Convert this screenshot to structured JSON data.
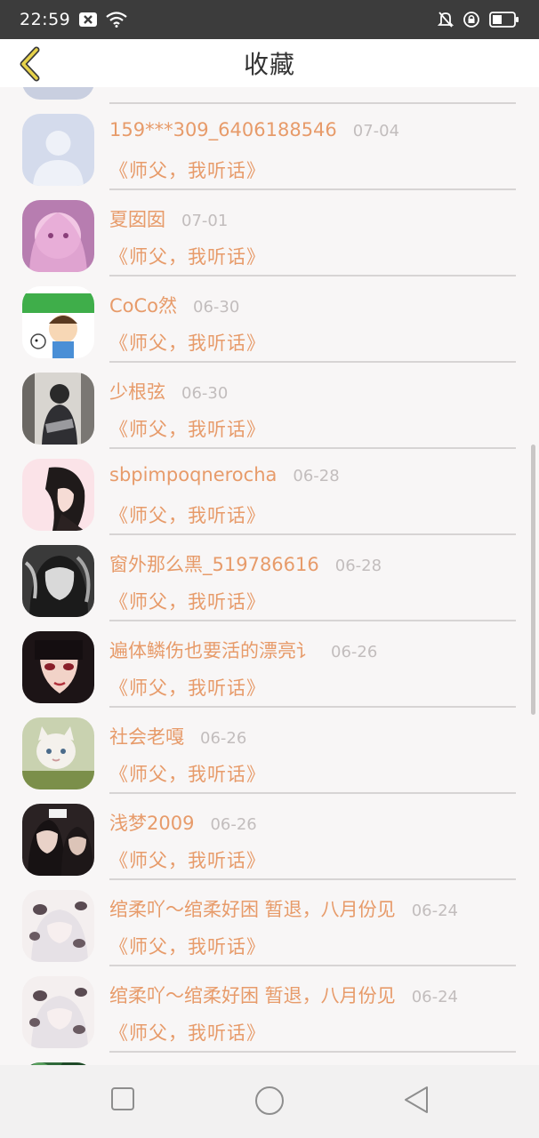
{
  "status_bar": {
    "time": "22:59",
    "left_icons": [
      "close-box-icon",
      "wifi-icon"
    ],
    "right_icons": [
      "bell-muted-icon",
      "lock-rotate-icon",
      "battery-icon"
    ]
  },
  "header": {
    "title": "收藏",
    "back_icon": "chevron-left-icon",
    "accent_color": "#e7d24a"
  },
  "colors": {
    "name_text": "#e79b6a",
    "date_text": "#c2bdbd",
    "divider": "#d7d4d4",
    "background": "#f8f6f6"
  },
  "favorites": [
    {
      "name": "",
      "date": "",
      "subtitle": "",
      "avatar": "avatar-partial"
    },
    {
      "name": "159***309_6406188546",
      "date": "07-04",
      "subtitle": "《师父，我听话》",
      "avatar": "default-avatar"
    },
    {
      "name": "夏囡囡",
      "date": "07-01",
      "subtitle": "《师父，我听话》",
      "avatar": "anime-girl-pink"
    },
    {
      "name": "CoCo然",
      "date": "06-30",
      "subtitle": "《师父，我听话》",
      "avatar": "cartoon-boy-green"
    },
    {
      "name": "少根弦",
      "date": "06-30",
      "subtitle": "《师父，我听话》",
      "avatar": "photo-person-dark"
    },
    {
      "name": "sbpimpoqnerocha",
      "date": "06-28",
      "subtitle": "《师父，我听话》",
      "avatar": "anime-pink-black"
    },
    {
      "name": "窗外那么黑_519786616",
      "date": "06-28",
      "subtitle": "《师父，我听话》",
      "avatar": "bw-photo-girl"
    },
    {
      "name": "遍体鳞伤也要活的漂亮讠",
      "date": "06-26",
      "subtitle": "《师父，我听话》",
      "avatar": "anime-girl-dark-hair"
    },
    {
      "name": "社会老嘎",
      "date": "06-26",
      "subtitle": "《师父，我听话》",
      "avatar": "white-cat"
    },
    {
      "name": "浅梦2009",
      "date": "06-26",
      "subtitle": "《师父，我听话》",
      "avatar": "photo-girls-dark"
    },
    {
      "name": "绾柔吖～绾柔好困 暂退，八月份见",
      "date": "06-24",
      "subtitle": "《师父，我听话》",
      "avatar": "anime-cow-light"
    },
    {
      "name": "绾柔吖～绾柔好困 暂退，八月份见",
      "date": "06-24",
      "subtitle": "《师父，我听话》",
      "avatar": "anime-cow-light"
    },
    {
      "name": "",
      "date": "",
      "subtitle": "",
      "avatar": "green-photo"
    }
  ],
  "nav_bar": {
    "icons": [
      "square-recents-icon",
      "circle-home-icon",
      "triangle-back-icon"
    ]
  }
}
